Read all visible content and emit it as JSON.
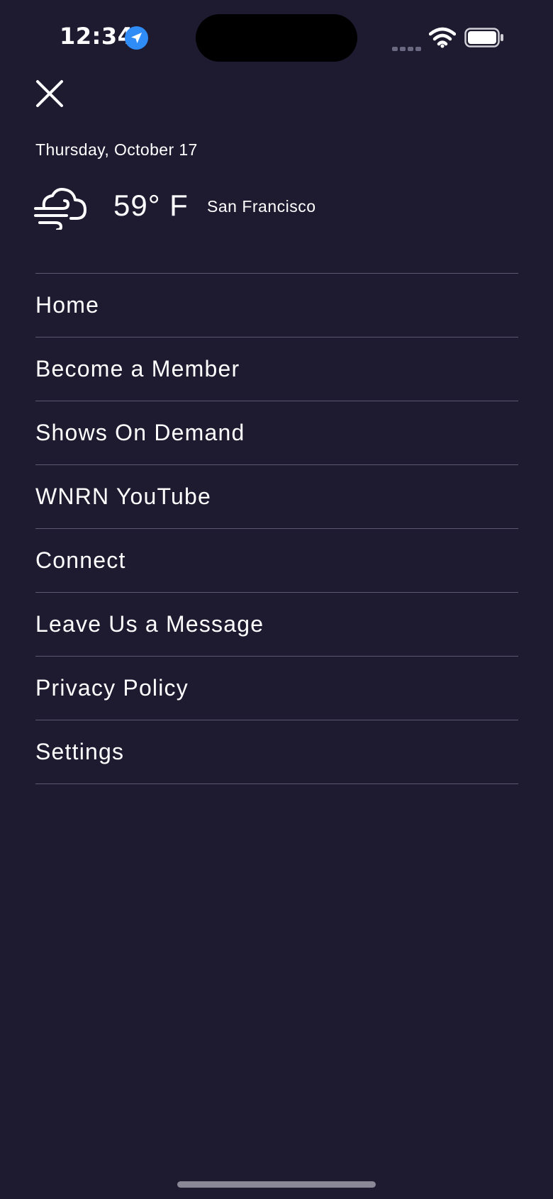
{
  "status_bar": {
    "time": "12:34"
  },
  "header": {
    "date": "Thursday, October 17",
    "temperature": "59° F",
    "city": "San Francisco",
    "weather_icon": "wind-cloud-icon"
  },
  "menu": {
    "items": [
      {
        "label": "Home"
      },
      {
        "label": "Become a Member"
      },
      {
        "label": "Shows On Demand"
      },
      {
        "label": "WNRN YouTube"
      },
      {
        "label": "Connect"
      },
      {
        "label": "Leave Us a Message"
      },
      {
        "label": "Privacy Policy"
      },
      {
        "label": "Settings"
      }
    ]
  },
  "colors": {
    "background": "#1e1b31",
    "divider": "#5b5870",
    "location_badge": "#2f8bf6"
  }
}
